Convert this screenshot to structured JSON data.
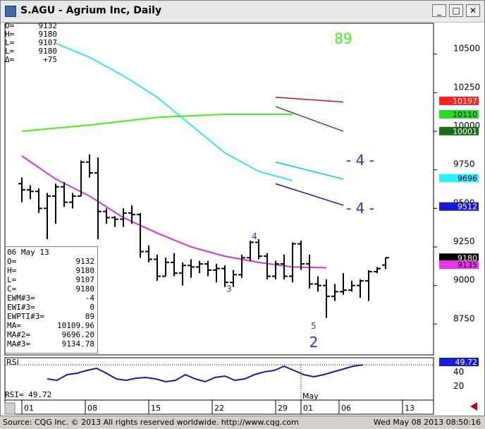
{
  "window": {
    "title": "S.AGU - Agrium Inc, Daily",
    "min_btn": "_",
    "max_btn": "□",
    "close_btn": "✕"
  },
  "ohlc_panel": [
    {
      "k": "O=",
      "v": "9132"
    },
    {
      "k": "H=",
      "v": "9180"
    },
    {
      "k": "L=",
      "v": "9107"
    },
    {
      "k": "L=",
      "v": "9180"
    },
    {
      "k": "Δ=",
      "v": "+75"
    }
  ],
  "info_box": {
    "date": "06 May 13",
    "rows": [
      {
        "k": "O=",
        "v": "9132"
      },
      {
        "k": "H=",
        "v": "9180"
      },
      {
        "k": "L=",
        "v": "9107"
      },
      {
        "k": "C=",
        "v": "9180"
      },
      {
        "k": "EWM#3=",
        "v": "-4"
      },
      {
        "k": "EWI#3=",
        "v": "0"
      },
      {
        "k": "EWPTI#3=",
        "v": "89"
      },
      {
        "k": "MA=",
        "v": "10109.96"
      },
      {
        "k": "MA#2=",
        "v": "9696.20"
      },
      {
        "k": "MA#3=",
        "v": "9134.78"
      }
    ]
  },
  "rsi_readout": "RSI=   49.72",
  "footer": {
    "source": "Source: CQG Inc. © 2013 All rights reserved worldwide.  http://www.cqg.com",
    "timestamp": "Wed May 08 2013  08:50:16"
  },
  "colors": {
    "bars": "#000000",
    "ma_cyan": "#33e5ee",
    "ma_green": "#44ee22",
    "ma_magenta": "#d633d6",
    "rsi_line": "#1a1aa0",
    "label_blue": "#3333aa",
    "label_green": "#2c8c2c"
  },
  "chart_data": {
    "type": "bar",
    "subtype": "ohlc",
    "price_axis": {
      "ticks": [
        10500,
        10250,
        10000,
        9750,
        9500,
        9250,
        9000,
        8750
      ],
      "min": 8550,
      "max": 10700
    },
    "x_labels": [
      {
        "label": "01",
        "day": 0
      },
      {
        "label": "08",
        "day": 5
      },
      {
        "label": "15",
        "day": 10
      },
      {
        "label": "22",
        "day": 15
      },
      {
        "label": "29",
        "day": 20
      },
      {
        "label": "01",
        "day": 22
      },
      {
        "label": "06",
        "day": 25
      },
      {
        "label": "13",
        "day": 30
      }
    ],
    "month_label": {
      "label": "May",
      "day": 22
    },
    "bars": [
      {
        "o": 9660,
        "h": 9700,
        "l": 9540,
        "c": 9620
      },
      {
        "o": 9620,
        "h": 9650,
        "l": 9560,
        "c": 9610
      },
      {
        "o": 9610,
        "h": 9630,
        "l": 9470,
        "c": 9500
      },
      {
        "o": 9500,
        "h": 9600,
        "l": 9300,
        "c": 9580
      },
      {
        "o": 9580,
        "h": 9660,
        "l": 9400,
        "c": 9640
      },
      {
        "o": 9640,
        "h": 9670,
        "l": 9510,
        "c": 9540
      },
      {
        "o": 9540,
        "h": 9600,
        "l": 9500,
        "c": 9580
      },
      {
        "o": 9580,
        "h": 9810,
        "l": 9580,
        "c": 9800
      },
      {
        "o": 9800,
        "h": 9850,
        "l": 9700,
        "c": 9730
      },
      {
        "o": 9730,
        "h": 9830,
        "l": 9300,
        "c": 9480
      },
      {
        "o": 9480,
        "h": 9500,
        "l": 9400,
        "c": 9440
      },
      {
        "o": 9440,
        "h": 9450,
        "l": 9380,
        "c": 9430
      },
      {
        "o": 9430,
        "h": 9500,
        "l": 9380,
        "c": 9470
      },
      {
        "o": 9470,
        "h": 9520,
        "l": 9400,
        "c": 9460
      },
      {
        "o": 9460,
        "h": 9470,
        "l": 9180,
        "c": 9220
      },
      {
        "o": 9220,
        "h": 9260,
        "l": 9150,
        "c": 9170
      },
      {
        "o": 9170,
        "h": 9200,
        "l": 9030,
        "c": 9060
      },
      {
        "o": 9060,
        "h": 9180,
        "l": 9060,
        "c": 9150
      },
      {
        "o": 9150,
        "h": 9210,
        "l": 9060,
        "c": 9080
      },
      {
        "o": 9080,
        "h": 9150,
        "l": 9000,
        "c": 9130
      },
      {
        "o": 9130,
        "h": 9170,
        "l": 9050,
        "c": 9120
      },
      {
        "o": 9120,
        "h": 9160,
        "l": 9080,
        "c": 9140
      },
      {
        "o": 9140,
        "h": 9160,
        "l": 9060,
        "c": 9100
      },
      {
        "o": 9100,
        "h": 9140,
        "l": 9020,
        "c": 9110
      },
      {
        "o": 9110,
        "h": 9130,
        "l": 8990,
        "c": 9020
      },
      {
        "o": 9020,
        "h": 9100,
        "l": 8990,
        "c": 9070
      },
      {
        "o": 9070,
        "h": 9200,
        "l": 9050,
        "c": 9180
      },
      {
        "o": 9180,
        "h": 9290,
        "l": 9160,
        "c": 9280
      },
      {
        "o": 9280,
        "h": 9300,
        "l": 9170,
        "c": 9190
      },
      {
        "o": 9190,
        "h": 9210,
        "l": 9040,
        "c": 9060
      },
      {
        "o": 9060,
        "h": 9160,
        "l": 9040,
        "c": 9140
      },
      {
        "o": 9140,
        "h": 9200,
        "l": 9040,
        "c": 9060
      },
      {
        "o": 9060,
        "h": 9280,
        "l": 9020,
        "c": 9270
      },
      {
        "o": 9270,
        "h": 9290,
        "l": 9100,
        "c": 9140
      },
      {
        "o": 9140,
        "h": 9200,
        "l": 8980,
        "c": 9010
      },
      {
        "o": 9010,
        "h": 9060,
        "l": 8960,
        "c": 9000
      },
      {
        "o": 9000,
        "h": 9040,
        "l": 8790,
        "c": 8930
      },
      {
        "o": 8930,
        "h": 9010,
        "l": 8900,
        "c": 8960
      },
      {
        "o": 8960,
        "h": 9080,
        "l": 8940,
        "c": 8970
      },
      {
        "o": 8970,
        "h": 9030,
        "l": 8960,
        "c": 9000
      },
      {
        "o": 9000,
        "h": 9040,
        "l": 8920,
        "c": 9030
      },
      {
        "o": 9030,
        "h": 9100,
        "l": 8900,
        "c": 9090
      },
      {
        "o": 9090,
        "h": 9120,
        "l": 9080,
        "c": 9110
      },
      {
        "o": 9132,
        "h": 9180,
        "l": 9107,
        "c": 9180
      }
    ],
    "series": [
      {
        "color": "cyan",
        "points": [
          [
            4,
            10570
          ],
          [
            8,
            10480
          ],
          [
            12,
            10360
          ],
          [
            16,
            10220
          ],
          [
            20,
            10040
          ],
          [
            24,
            9860
          ],
          [
            28,
            9740
          ],
          [
            32,
            9680
          ]
        ]
      },
      {
        "color": "green",
        "points": [
          [
            0,
            10000
          ],
          [
            8,
            10040
          ],
          [
            16,
            10090
          ],
          [
            24,
            10110
          ],
          [
            32,
            10110
          ]
        ]
      },
      {
        "color": "magenta",
        "points": [
          [
            0,
            9840
          ],
          [
            4,
            9690
          ],
          [
            8,
            9580
          ],
          [
            12,
            9440
          ],
          [
            16,
            9340
          ],
          [
            20,
            9250
          ],
          [
            24,
            9190
          ],
          [
            28,
            9150
          ],
          [
            32,
            9120
          ],
          [
            36,
            9115
          ]
        ]
      }
    ],
    "projections": [
      {
        "color": "#cc1111",
        "points": [
          [
            30,
            10220
          ],
          [
            38,
            10190
          ]
        ]
      },
      {
        "color": "#1a6b1a",
        "points": [
          [
            30,
            10160
          ],
          [
            38,
            10000
          ]
        ]
      },
      {
        "color": "#00c8d8",
        "points": [
          [
            30,
            9800
          ],
          [
            38,
            9690
          ]
        ]
      },
      {
        "color": "#1a1aa0",
        "points": [
          [
            30,
            9660
          ],
          [
            38,
            9520
          ]
        ]
      }
    ],
    "price_tags": [
      {
        "value": "10197",
        "price": 10197,
        "bg": "#ff2020",
        "fg": "#ffffff"
      },
      {
        "value": "10110",
        "price": 10110,
        "bg": "#22dd22",
        "fg": "#000000"
      },
      {
        "value": "10001",
        "price": 10001,
        "bg": "#1a6b1a",
        "fg": "#ffffff"
      },
      {
        "value": "9696",
        "price": 9696,
        "bg": "#33eeff",
        "fg": "#000000"
      },
      {
        "value": "9512",
        "price": 9512,
        "bg": "#1a1ad0",
        "fg": "#ffffff"
      },
      {
        "value": "9180",
        "price": 9180,
        "bg": "#000000",
        "fg": "#ffffff"
      },
      {
        "value": "9135",
        "price": 9135,
        "bg": "#ee33ee",
        "fg": "#000000"
      }
    ],
    "annotations": [
      {
        "text": "89",
        "day": 38,
        "price": 10570,
        "color": "green",
        "size": 20
      },
      {
        "text": "- 4 -",
        "day": 40,
        "price": 9780,
        "color": "blue",
        "size": 20
      },
      {
        "text": "- 4 -",
        "day": 40,
        "price": 9470,
        "color": "blue",
        "size": 20
      },
      {
        "text": "4",
        "day": 27.5,
        "price": 9300,
        "color": "blue",
        "size": 12
      },
      {
        "text": "3",
        "day": 24.5,
        "price": 8960,
        "color": "blue",
        "size": 12
      },
      {
        "text": "5",
        "day": 34.5,
        "price": 8720,
        "color": "blue",
        "size": 12
      },
      {
        "text": "2",
        "day": 34.5,
        "price": 8600,
        "color": "blue",
        "size": 20
      }
    ],
    "rsi": {
      "label": "RSI",
      "last": "49.72",
      "ticks": [
        40,
        20
      ],
      "min": 0,
      "max": 60,
      "values": [
        30,
        28,
        36,
        38,
        42,
        45,
        38,
        30,
        28,
        31,
        32,
        30,
        26,
        28,
        36,
        30,
        26,
        32,
        34,
        28,
        30,
        36,
        40,
        42,
        48,
        42,
        36,
        33,
        36,
        40,
        44,
        48,
        50
      ]
    }
  }
}
